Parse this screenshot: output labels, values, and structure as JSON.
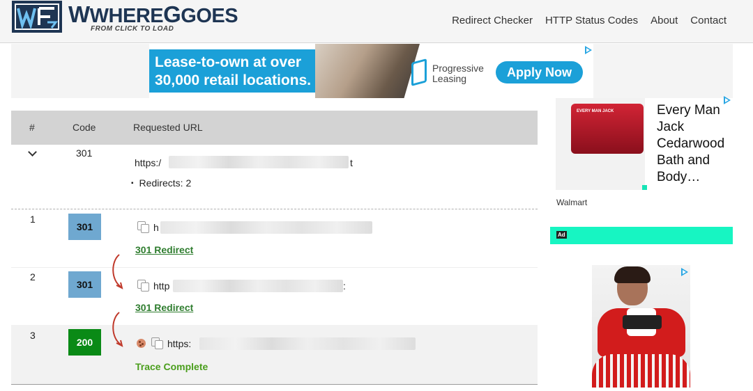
{
  "header": {
    "brand_where": "WHERE",
    "brand_goes": "GOES",
    "tagline": "FROM CLICK TO LOAD",
    "nav": [
      "Redirect Checker",
      "HTTP Status Codes",
      "About",
      "Contact"
    ]
  },
  "top_ad": {
    "headline_line1": "Lease-to-own at over",
    "headline_line2": "30,000 retail locations.",
    "brand_line1": "Progressive",
    "brand_line2": "Leasing",
    "cta": "Apply Now"
  },
  "table": {
    "headers": {
      "num": "#",
      "code": "Code",
      "url": "Requested URL"
    },
    "summary": {
      "code": "301",
      "url_prefix": "https:/",
      "url_suffix": "t",
      "redirects": "Redirects: 2"
    },
    "hops": [
      {
        "num": "1",
        "code": "301",
        "url_prefix": "h",
        "status": "301 Redirect"
      },
      {
        "num": "2",
        "code": "301",
        "url_prefix": "http",
        "url_suffix": ":",
        "status": "301 Redirect"
      },
      {
        "num": "3",
        "code": "200",
        "url_prefix": "https:",
        "status": "Trace Complete"
      }
    ]
  },
  "side_ad": {
    "product_label": "EVERY MAN JACK",
    "title": "Every Man Jack Cedarwood Bath and Body…",
    "merchant": "Walmart",
    "ad_label": "Ad"
  },
  "colors": {
    "brand_navy": "#1e3553",
    "badge_301": "#6fa8d0",
    "badge_200": "#0a8a16",
    "link_green": "#2f7d2f",
    "ad_teal": "#1ba0d8",
    "ad_mint": "#17f5c2"
  }
}
